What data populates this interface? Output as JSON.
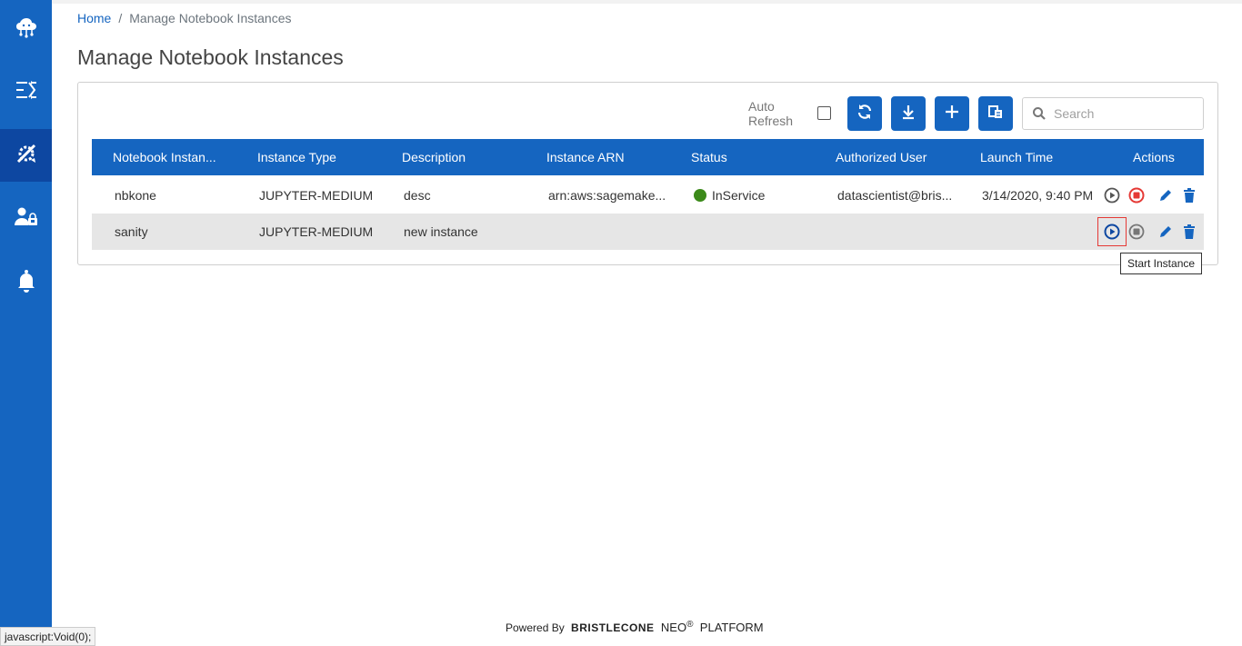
{
  "sidebar": {
    "items": [
      {
        "icon": "cloud-network-icon"
      },
      {
        "icon": "shuffle-list-icon"
      },
      {
        "icon": "notebook-tools-icon",
        "active": true
      },
      {
        "icon": "user-lock-icon"
      },
      {
        "icon": "bell-icon"
      }
    ]
  },
  "breadcrumb": {
    "home": "Home",
    "separator": "/",
    "current": "Manage Notebook Instances"
  },
  "page": {
    "title": "Manage Notebook Instances"
  },
  "toolbar": {
    "auto_refresh_line1": "Auto",
    "auto_refresh_line2": "Refresh",
    "auto_refresh_checked": false,
    "buttons": [
      "refresh-icon",
      "download-icon",
      "add-icon",
      "copy-icon"
    ],
    "search_placeholder": "Search"
  },
  "table": {
    "columns": [
      "Notebook Instan...",
      "Instance Type",
      "Description",
      "Instance ARN",
      "Status",
      "Authorized User",
      "Launch Time",
      "Actions"
    ],
    "rows": [
      {
        "name": "nbkone",
        "type": "JUPYTER-MEDIUM",
        "description": "desc",
        "arn": "arn:aws:sagemake...",
        "status": "InService",
        "user": "datascientist@bris...",
        "launch": "3/14/2020, 9:40 PM"
      },
      {
        "name": "sanity",
        "type": "JUPYTER-MEDIUM",
        "description": "new instance",
        "arn": "",
        "status": "",
        "user": "",
        "launch": ""
      }
    ]
  },
  "tooltip": {
    "text": "Start Instance"
  },
  "footer": {
    "powered_by": "Powered By",
    "brand": "BRISTLECONE",
    "neo": "NEO",
    "reg": "®",
    "platform": "PLATFORM"
  },
  "statusbar": {
    "text": "javascript:Void(0);"
  },
  "colors": {
    "primary": "#1565c0",
    "sidebar_active": "#0d47a1",
    "status_green": "#3c8a1a",
    "stop_red": "#e53935"
  }
}
